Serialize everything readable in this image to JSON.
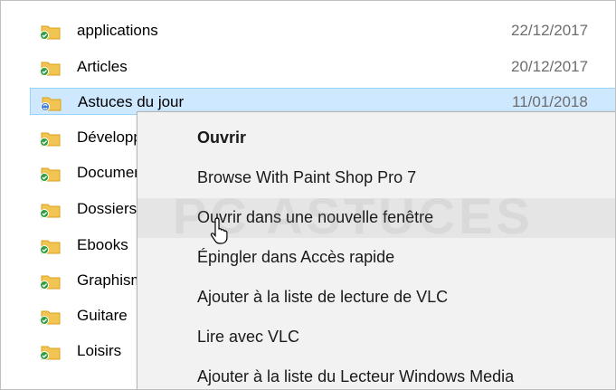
{
  "files": [
    {
      "name": "applications",
      "date": "22/12/2017",
      "status": "synced"
    },
    {
      "name": "Articles",
      "date": "20/12/2017",
      "status": "synced"
    },
    {
      "name": "Astuces du jour",
      "date": "11/01/2018",
      "status": "syncing",
      "selected": true
    },
    {
      "name": "Développement",
      "date": "",
      "status": "synced"
    },
    {
      "name": "Documents",
      "date": "",
      "status": "synced"
    },
    {
      "name": "Dossiers",
      "date": "",
      "status": "synced"
    },
    {
      "name": "Ebooks",
      "date": "",
      "status": "synced"
    },
    {
      "name": "Graphisme",
      "date": "",
      "status": "synced"
    },
    {
      "name": "Guitare",
      "date": "",
      "status": "synced"
    },
    {
      "name": "Loisirs",
      "date": "",
      "status": "synced"
    }
  ],
  "context_menu": {
    "items": [
      {
        "label": "Ouvrir",
        "bold": true
      },
      {
        "label": "Browse With Paint Shop Pro 7"
      },
      {
        "label": "Ouvrir dans une nouvelle fenêtre",
        "hovered": true
      },
      {
        "label": "Épingler dans Accès rapide"
      },
      {
        "label": "Ajouter à la liste de lecture de VLC"
      },
      {
        "label": "Lire avec VLC"
      },
      {
        "label": "Ajouter à la liste du Lecteur Windows Media"
      }
    ]
  },
  "watermark": "PC ASTUCES",
  "colors": {
    "folder": "#f2c453",
    "folder_dark": "#d9a21b",
    "sync_ok": "#2e9e3f",
    "sync_pending": "#3b78d8",
    "selection": "#cde8ff",
    "menu_bg": "#f2f2f2",
    "menu_hover": "#e5e5e5"
  }
}
